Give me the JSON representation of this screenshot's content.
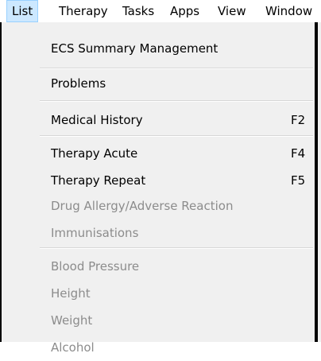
{
  "menubar": {
    "items": [
      {
        "label": "List"
      },
      {
        "label": "Therapy"
      },
      {
        "label": "Tasks"
      },
      {
        "label": "Apps"
      },
      {
        "label": "View"
      },
      {
        "label": "Window"
      }
    ]
  },
  "menu": {
    "items": [
      {
        "label": "ECS Summary Management",
        "shortcut": "",
        "enabled": true
      },
      {
        "label": "Problems",
        "shortcut": "",
        "enabled": true
      },
      {
        "label": "Medical History",
        "shortcut": "F2",
        "enabled": true
      },
      {
        "label": "Therapy Acute",
        "shortcut": "F4",
        "enabled": true
      },
      {
        "label": "Therapy Repeat",
        "shortcut": "F5",
        "enabled": true
      },
      {
        "label": "Drug Allergy/Adverse Reaction",
        "shortcut": "",
        "enabled": false
      },
      {
        "label": "Immunisations",
        "shortcut": "",
        "enabled": false
      },
      {
        "label": "Blood Pressure",
        "shortcut": "",
        "enabled": false
      },
      {
        "label": "Height",
        "shortcut": "",
        "enabled": false
      },
      {
        "label": "Weight",
        "shortcut": "",
        "enabled": false
      },
      {
        "label": "Alcohol",
        "shortcut": "",
        "enabled": false
      }
    ]
  },
  "colors": {
    "menu_background": "#f0f0f0",
    "active_menu_highlight": "#cce8ff",
    "disabled_text": "#8c8c8c"
  }
}
